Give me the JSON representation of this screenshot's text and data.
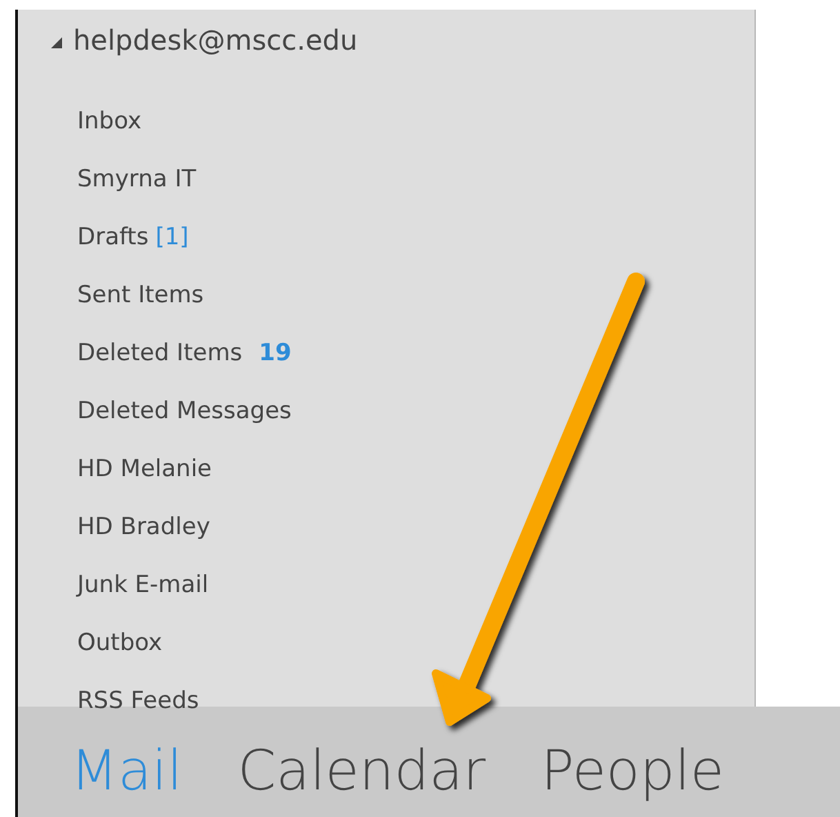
{
  "account": {
    "name": "helpdesk@mscc.edu",
    "expanded": true
  },
  "folders": [
    {
      "name": "Inbox"
    },
    {
      "name": "Smyrna IT"
    },
    {
      "name": "Drafts",
      "count": "[1]",
      "count_bold": false
    },
    {
      "name": "Sent Items"
    },
    {
      "name": "Deleted Items",
      "count": "19",
      "count_bold": true
    },
    {
      "name": "Deleted Messages"
    },
    {
      "name": "HD Melanie"
    },
    {
      "name": "HD Bradley"
    },
    {
      "name": "Junk E-mail"
    },
    {
      "name": "Outbox"
    },
    {
      "name": "RSS Feeds"
    }
  ],
  "nav": [
    {
      "label": "Mail",
      "selected": true
    },
    {
      "label": "Calendar",
      "selected": false
    },
    {
      "label": "People",
      "selected": false
    }
  ]
}
